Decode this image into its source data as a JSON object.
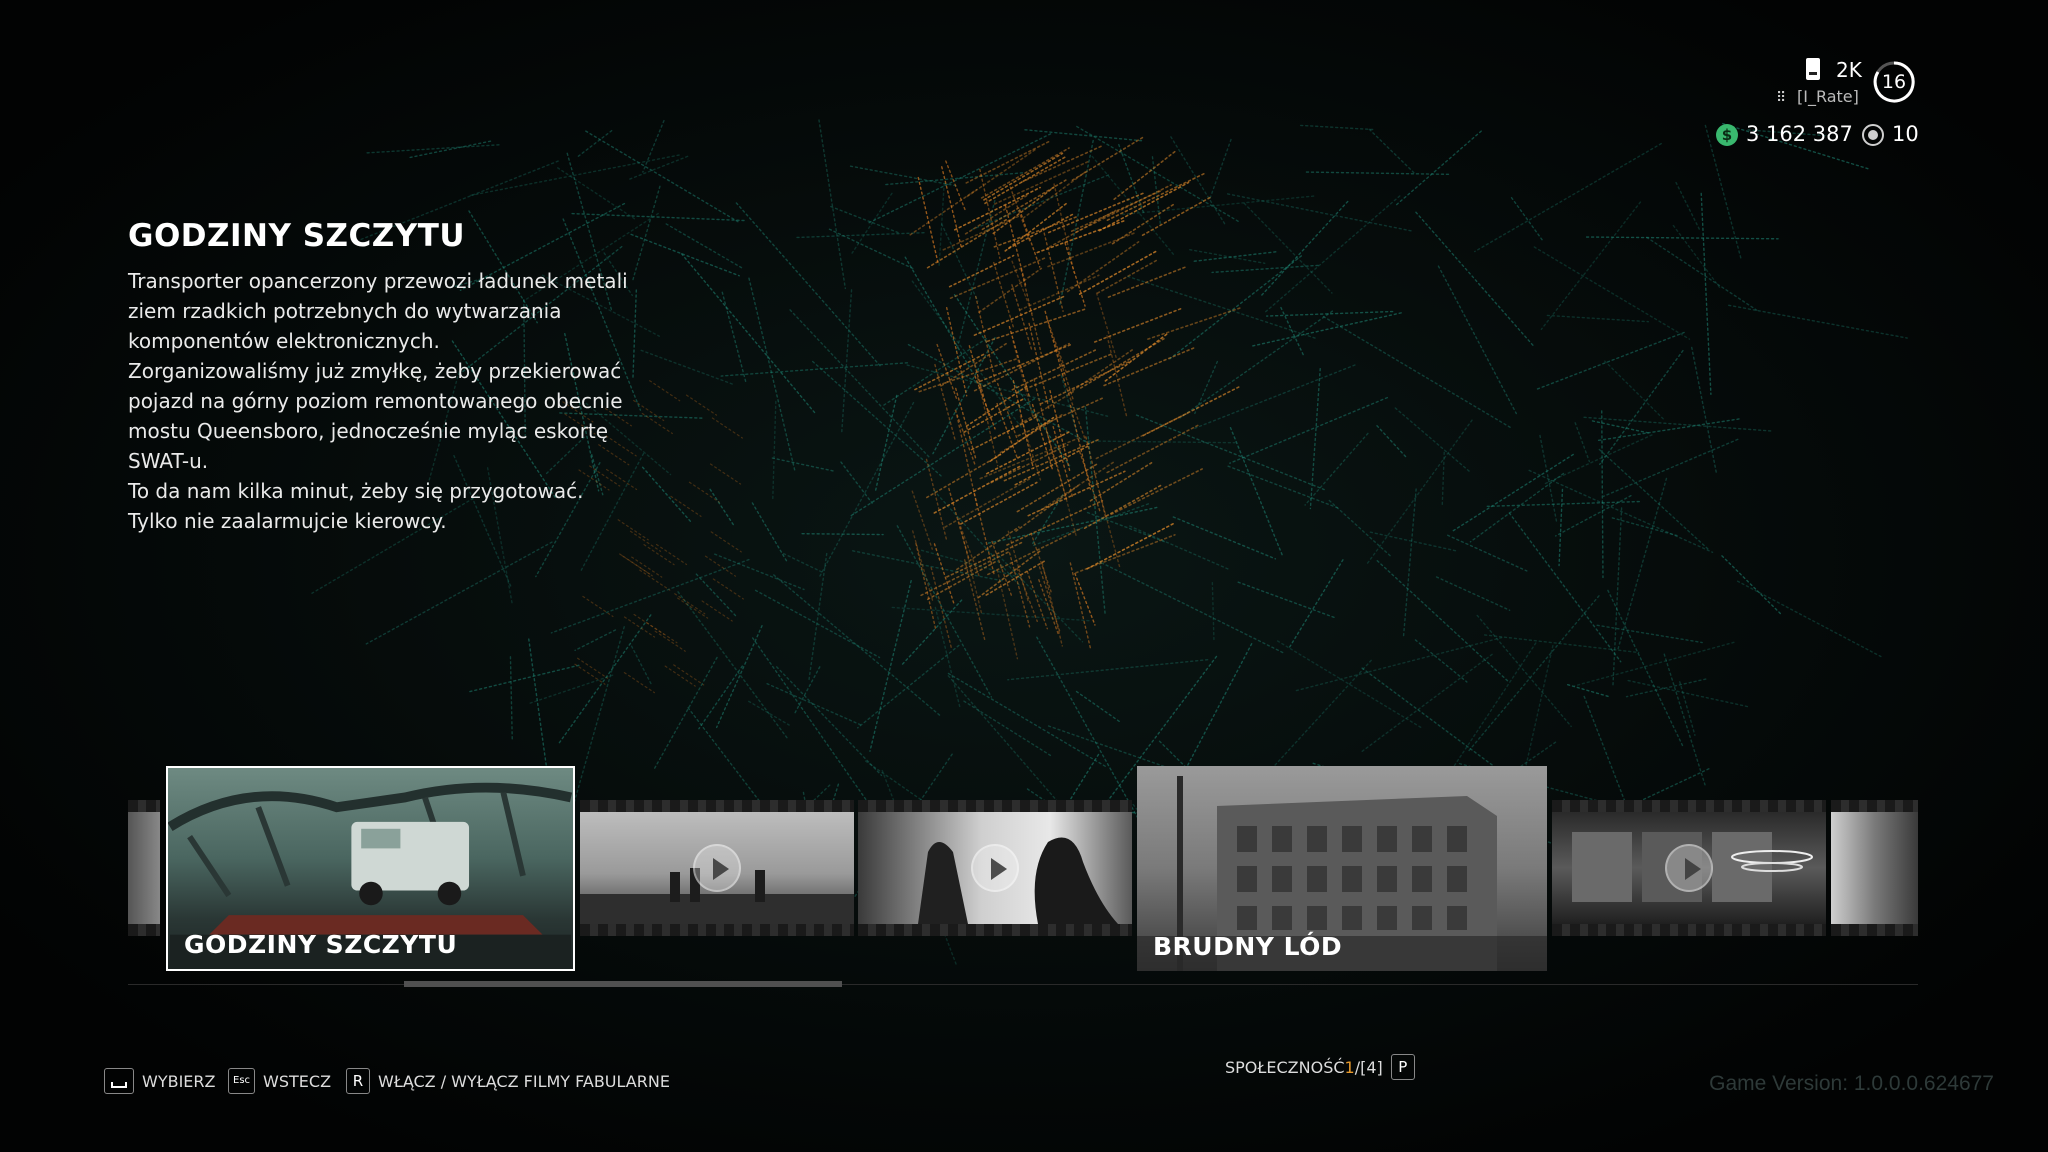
{
  "hud": {
    "player_name": "2K",
    "crew_name": "[I_Rate]",
    "level": "16",
    "money": "3 162 387",
    "tokens": "10",
    "icons": [
      "player-icon",
      "crew-group-icon",
      "level-ring",
      "money-icon",
      "token-icon"
    ]
  },
  "mission": {
    "title": "GODZINY SZCZYTU",
    "description_lines": [
      "Transporter opancerzony przewozi ładunek metali",
      "ziem rzadkich potrzebnych do wytwarzania",
      "komponentów elektronicznych.",
      "Zorganizowaliśmy już zmyłkę, żeby przekierować",
      "pojazd na górny poziom remontowanego obecnie",
      "mostu Queensboro, jednocześnie myląc eskortę",
      "SWAT-u.",
      "To da nam kilka minut, żeby się przygotować.",
      "Tylko nie zaalarmujcie kierowcy."
    ]
  },
  "carousel": {
    "selected_label": "GODZINY SZCZYTU",
    "mission_card_label": "BRUDNY LÓD",
    "accent_color": "#e89a2c"
  },
  "controls": {
    "select_label": "WYBIERZ",
    "select_key": "",
    "back_label": "WSTECZ",
    "back_key": "Esc",
    "toggle_label": "WŁĄCZ / WYŁĄCZ FILMY FABULARNE",
    "toggle_key": "R"
  },
  "community": {
    "label": "SPOŁECZNOŚĆ",
    "current": "1",
    "separator": "/",
    "total": "[4]",
    "key": "P"
  },
  "version": "Game Version: 1.0.0.0.624677"
}
